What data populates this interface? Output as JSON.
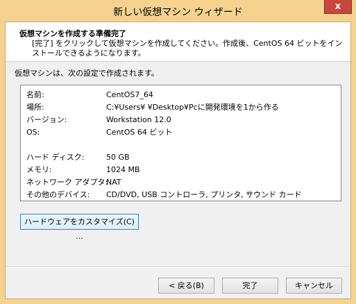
{
  "window": {
    "title": "新しい仮想マシン ウィザード",
    "close_glyph": "x"
  },
  "header": {
    "title": "仮想マシンを作成する準備完了",
    "description": "[完了] をクリックして仮想マシンを作成してください。作成後、CentOS 64 ビットをインストールできるようになります。"
  },
  "intro": "仮想マシンは、次の設定で作成されます。",
  "summary": {
    "rows": [
      {
        "label": "名前:",
        "value": "CentOS7_64"
      },
      {
        "label": "場所:",
        "value": "C:¥Users¥            ¥Desktop¥Pcに開発環境を1から作る"
      },
      {
        "label": "バージョン:",
        "value": "Workstation 12.0"
      },
      {
        "label": "OS:",
        "value": "CentOS 64 ビット"
      },
      {
        "label": "ハード ディスク:",
        "value": "50 GB"
      },
      {
        "label": "メモリ:",
        "value": "1024 MB"
      },
      {
        "label": "ネットワーク アダプタ:",
        "value": "NAT"
      },
      {
        "label": "その他のデバイス:",
        "value": "CD/DVD, USB コントローラ, プリンタ, サウンド カード"
      }
    ]
  },
  "buttons": {
    "customize": "ハードウェアをカスタマイズ(C) ...",
    "back": "< 戻る(B)",
    "finish": "完了",
    "cancel": "キャンセル"
  }
}
